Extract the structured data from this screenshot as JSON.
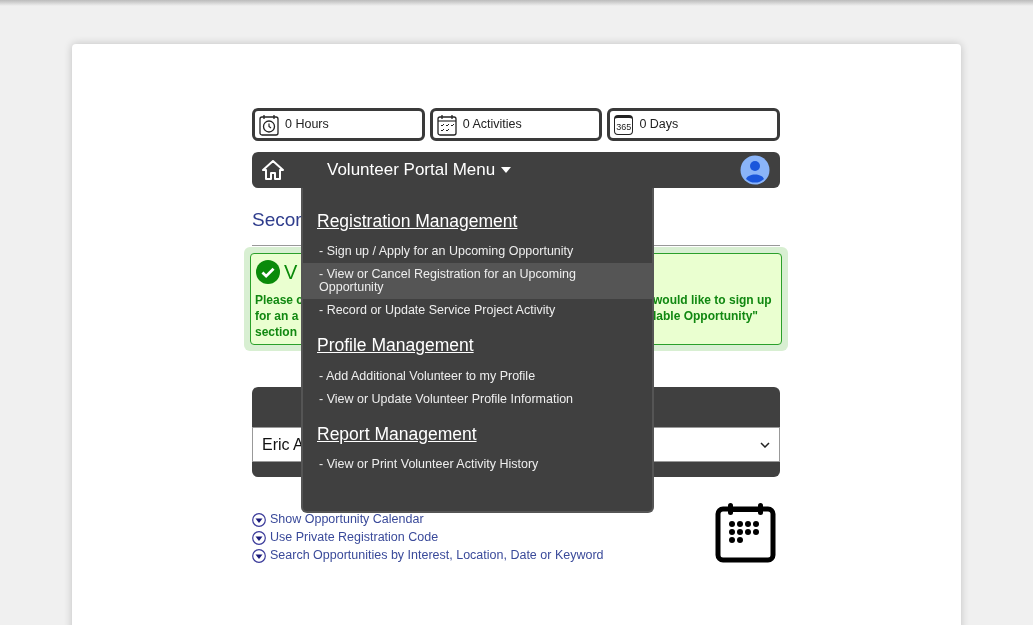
{
  "stats": [
    {
      "kind": "clock",
      "label": "0 Hours"
    },
    {
      "kind": "checklist",
      "label": "0 Activities"
    },
    {
      "kind": "year",
      "icon_text": "365",
      "label": "0 Days"
    }
  ],
  "nav": {
    "title": "Volunteer Portal Menu"
  },
  "menu": [
    {
      "heading": "Registration Management",
      "items": [
        {
          "label": "- Sign up / Apply for an Upcoming Opportunity",
          "selected": false
        },
        {
          "label": "- View or Cancel Registration for an Upcoming Opportunity",
          "selected": true
        },
        {
          "label": "- Record or Update Service Project Activity",
          "selected": false
        }
      ]
    },
    {
      "heading": "Profile Management",
      "items": [
        {
          "label": "- Add Additional Volunteer to my Profile",
          "selected": false
        },
        {
          "label": "- View or Update Volunteer Profile Information",
          "selected": false
        }
      ]
    },
    {
      "heading": "Report Management",
      "items": [
        {
          "label": "- View or Print Volunteer Activity History",
          "selected": false
        }
      ]
    }
  ],
  "section_heading": "Secor",
  "notice": {
    "title": "V",
    "lines": [
      {
        "left": "Please c",
        "right": "would like to sign up"
      },
      {
        "left": "for an a",
        "right": "lable Opportunity\""
      },
      {
        "left": "section"
      }
    ]
  },
  "volunteer_select": {
    "value": "Eric A"
  },
  "links": [
    "Show Opportunity Calendar",
    "Use Private Registration Code",
    "Search Opportunities by Interest, Location, Date or Keyword"
  ]
}
